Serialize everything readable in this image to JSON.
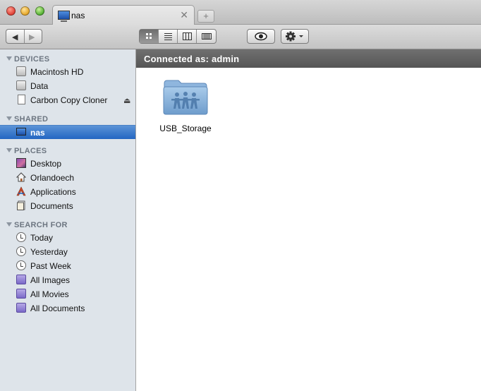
{
  "window": {
    "tab_title": "nas",
    "tab_close": "✕",
    "new_tab": "+"
  },
  "toolbar": {
    "back": "◀",
    "forward": "▶",
    "views": [
      "icon-view",
      "list-view",
      "column-view",
      "cover-flow-view"
    ],
    "active_view": "icon-view"
  },
  "sidebar": {
    "sections": [
      {
        "title": "DEVICES",
        "items": [
          {
            "label": "Macintosh HD",
            "icon": "hard-drive-icon"
          },
          {
            "label": "Data",
            "icon": "hard-drive-icon"
          },
          {
            "label": "Carbon Copy Cloner",
            "icon": "disk-image-icon",
            "eject": "⏏"
          }
        ]
      },
      {
        "title": "SHARED",
        "items": [
          {
            "label": "nas",
            "icon": "network-server-icon",
            "selected": true
          }
        ]
      },
      {
        "title": "PLACES",
        "items": [
          {
            "label": "Desktop",
            "icon": "desktop-icon"
          },
          {
            "label": "Orlandoech",
            "icon": "home-icon"
          },
          {
            "label": "Applications",
            "icon": "applications-icon"
          },
          {
            "label": "Documents",
            "icon": "documents-icon"
          }
        ]
      },
      {
        "title": "SEARCH FOR",
        "items": [
          {
            "label": "Today",
            "icon": "clock-icon"
          },
          {
            "label": "Yesterday",
            "icon": "clock-icon"
          },
          {
            "label": "Past Week",
            "icon": "clock-icon"
          },
          {
            "label": "All Images",
            "icon": "smart-folder-icon"
          },
          {
            "label": "All Movies",
            "icon": "smart-folder-icon"
          },
          {
            "label": "All Documents",
            "icon": "smart-folder-icon"
          }
        ]
      }
    ]
  },
  "main": {
    "connection_status": "Connected as: admin",
    "items": [
      {
        "label": "USB_Storage",
        "icon": "shared-folder-icon"
      }
    ]
  },
  "colors": {
    "sidebar_bg": "#dee4ea",
    "selection": "#2366c2",
    "pathbar": "#5e5e5e"
  }
}
